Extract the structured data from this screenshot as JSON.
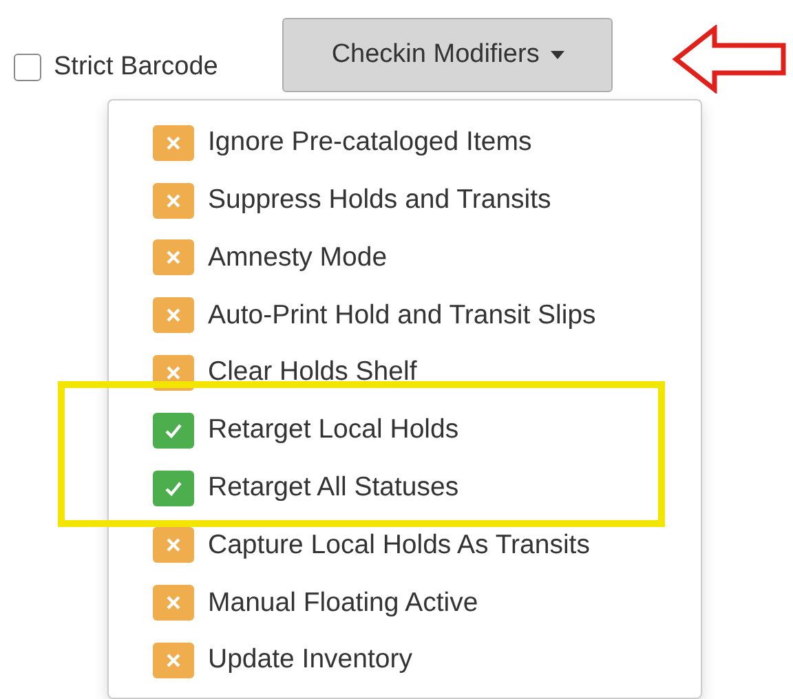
{
  "strict_barcode": {
    "label": "Strict Barcode",
    "checked": false
  },
  "modifiers_button": {
    "label": "Checkin Modifiers"
  },
  "menu": {
    "items": [
      {
        "label": "Ignore Pre-cataloged Items",
        "enabled": false
      },
      {
        "label": "Suppress Holds and Transits",
        "enabled": false
      },
      {
        "label": "Amnesty Mode",
        "enabled": false
      },
      {
        "label": "Auto-Print Hold and Transit Slips",
        "enabled": false
      },
      {
        "label": "Clear Holds Shelf",
        "enabled": false
      },
      {
        "label": "Retarget Local Holds",
        "enabled": true
      },
      {
        "label": "Retarget All Statuses",
        "enabled": true
      },
      {
        "label": "Capture Local Holds As Transits",
        "enabled": false
      },
      {
        "label": "Manual Floating Active",
        "enabled": false
      },
      {
        "label": "Update Inventory",
        "enabled": false
      }
    ]
  }
}
